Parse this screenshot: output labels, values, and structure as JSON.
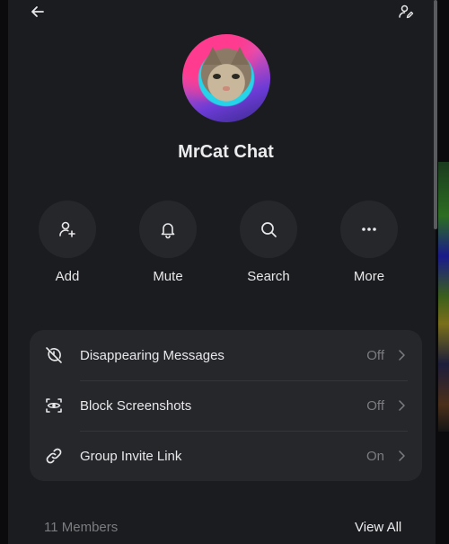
{
  "header": {
    "back_icon": "arrow-left-icon",
    "edit_icon": "person-edit-icon"
  },
  "group": {
    "name": "MrCat Chat",
    "avatar_desc": "cat photo avatar"
  },
  "actions": [
    {
      "label": "Add",
      "icon": "person-add-icon"
    },
    {
      "label": "Mute",
      "icon": "bell-icon"
    },
    {
      "label": "Search",
      "icon": "search-icon"
    },
    {
      "label": "More",
      "icon": "more-horizontal-icon"
    }
  ],
  "settings": [
    {
      "label": "Disappearing Messages",
      "value": "Off",
      "icon": "timer-off-icon"
    },
    {
      "label": "Block Screenshots",
      "value": "Off",
      "icon": "screenshot-block-icon"
    },
    {
      "label": "Group Invite Link",
      "value": "On",
      "icon": "link-icon"
    }
  ],
  "members": {
    "count_label": "11 Members",
    "view_all_label": "View All"
  },
  "colors": {
    "panel_bg": "#1b1c1f",
    "card_bg": "#26272b",
    "muted_text": "#7b7c80",
    "primary_text": "#e8e8ea"
  }
}
